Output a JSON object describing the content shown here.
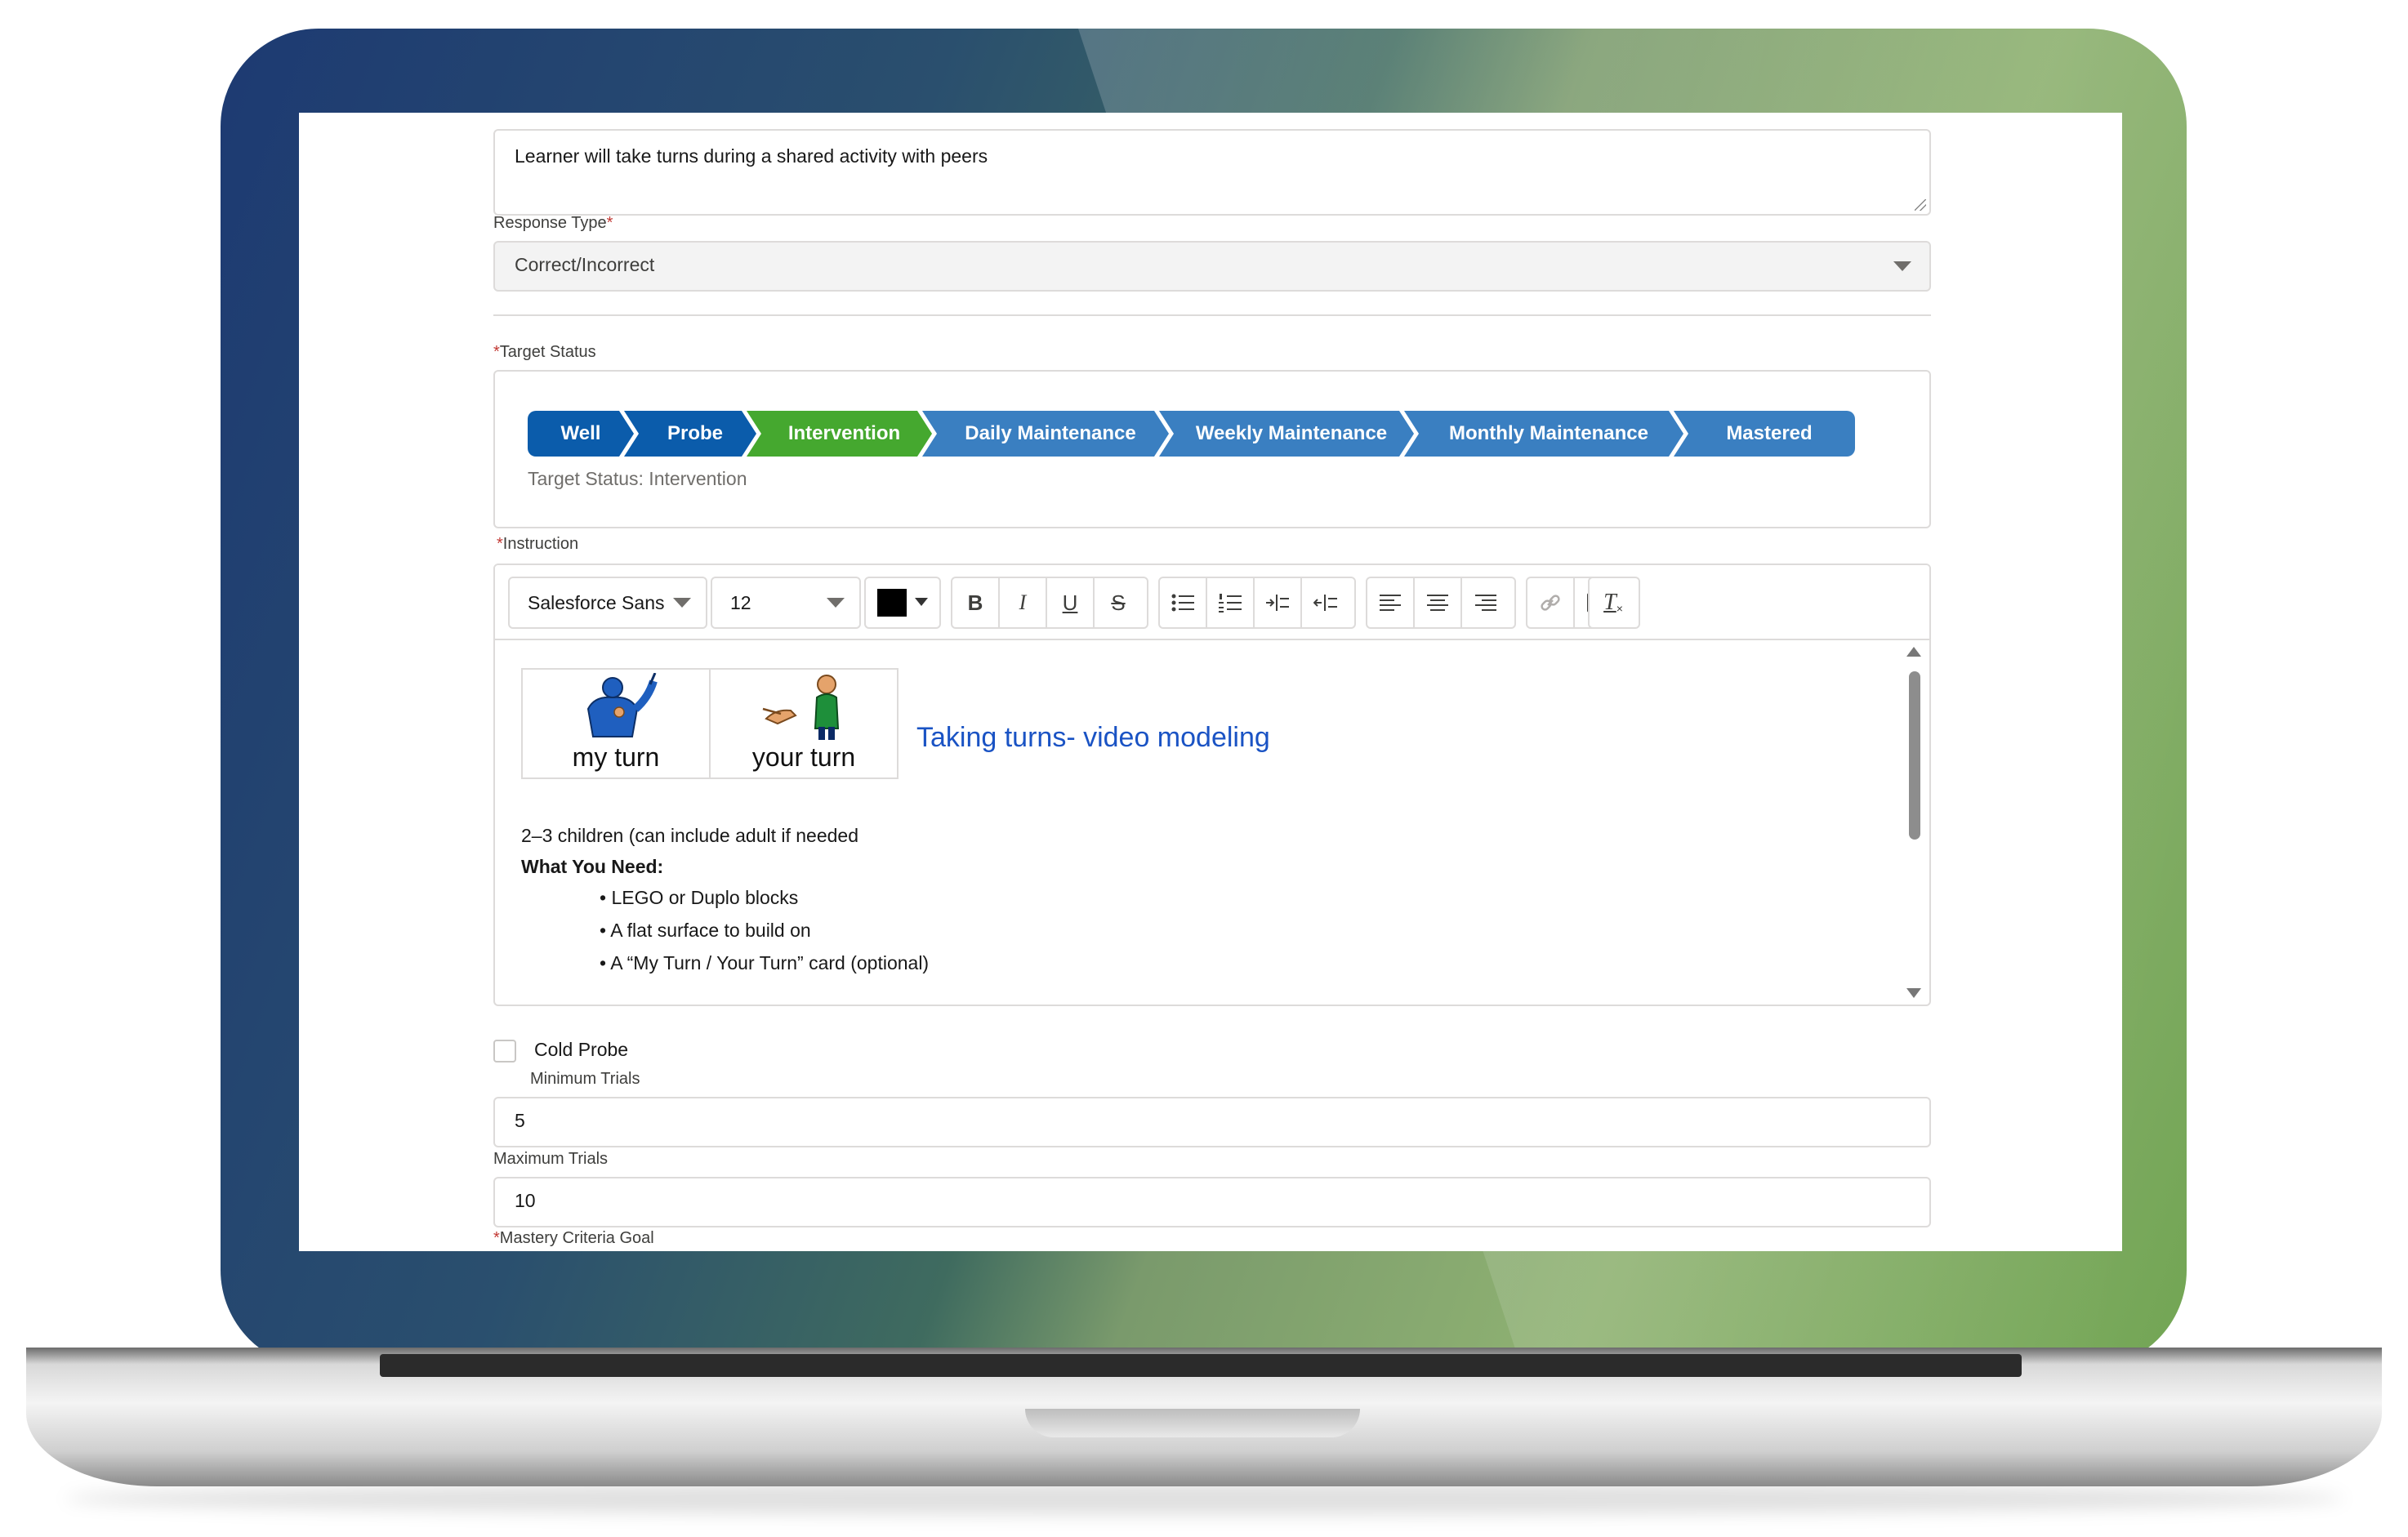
{
  "form": {
    "description_value": "Learner will take turns during a shared activity with peers",
    "response_type": {
      "label": "Response Type",
      "required_mark": "*",
      "value": "Correct/Incorrect"
    },
    "target_status": {
      "label": "Target Status",
      "required_mark": "*",
      "stages": [
        "Well",
        "Probe",
        "Intervention",
        "Daily Maintenance",
        "Weekly Maintenance",
        "Monthly Maintenance",
        "Mastered"
      ],
      "current_index": 2,
      "caption": "Target Status: Intervention",
      "colors": {
        "complete": "#0b5cab",
        "current": "#45a82f",
        "upcoming": "#3a7fc1"
      }
    },
    "instruction": {
      "label": "Instruction",
      "required_mark": "*",
      "toolbar": {
        "font_family": "Salesforce Sans",
        "font_size": "12",
        "text_color": "#000000",
        "buttons": [
          "bold-icon",
          "italic-icon",
          "underline-icon",
          "strikethrough-icon",
          "bulleted-list-icon",
          "numbered-list-icon",
          "indent-icon",
          "outdent-icon",
          "align-left-icon",
          "align-center-icon",
          "align-right-icon",
          "link-icon",
          "image-icon",
          "clear-formatting-icon"
        ],
        "glyphs": {
          "bold": "B",
          "italic": "I",
          "underline": "U",
          "strike": "S",
          "clear": "T"
        }
      },
      "images": [
        {
          "caption": "my turn"
        },
        {
          "caption": "your turn"
        }
      ],
      "link_text": "Taking turns- video modeling",
      "lines": {
        "intro": "2–3 children (can include adult if needed",
        "heading": "What You Need:",
        "bullets": [
          "LEGO or Duplo blocks",
          "A flat surface to build on",
          "A “My Turn / Your Turn” card (optional)"
        ],
        "bullet_char": "•"
      }
    },
    "cold_probe": {
      "label": "Cold Probe",
      "checked": false
    },
    "minimum_trials": {
      "label": "Minimum Trials",
      "value": "5"
    },
    "maximum_trials": {
      "label": "Maximum Trials",
      "value": "10"
    },
    "mastery_criteria_goal": {
      "label": "Mastery Criteria Goal",
      "required_mark": "*"
    }
  }
}
